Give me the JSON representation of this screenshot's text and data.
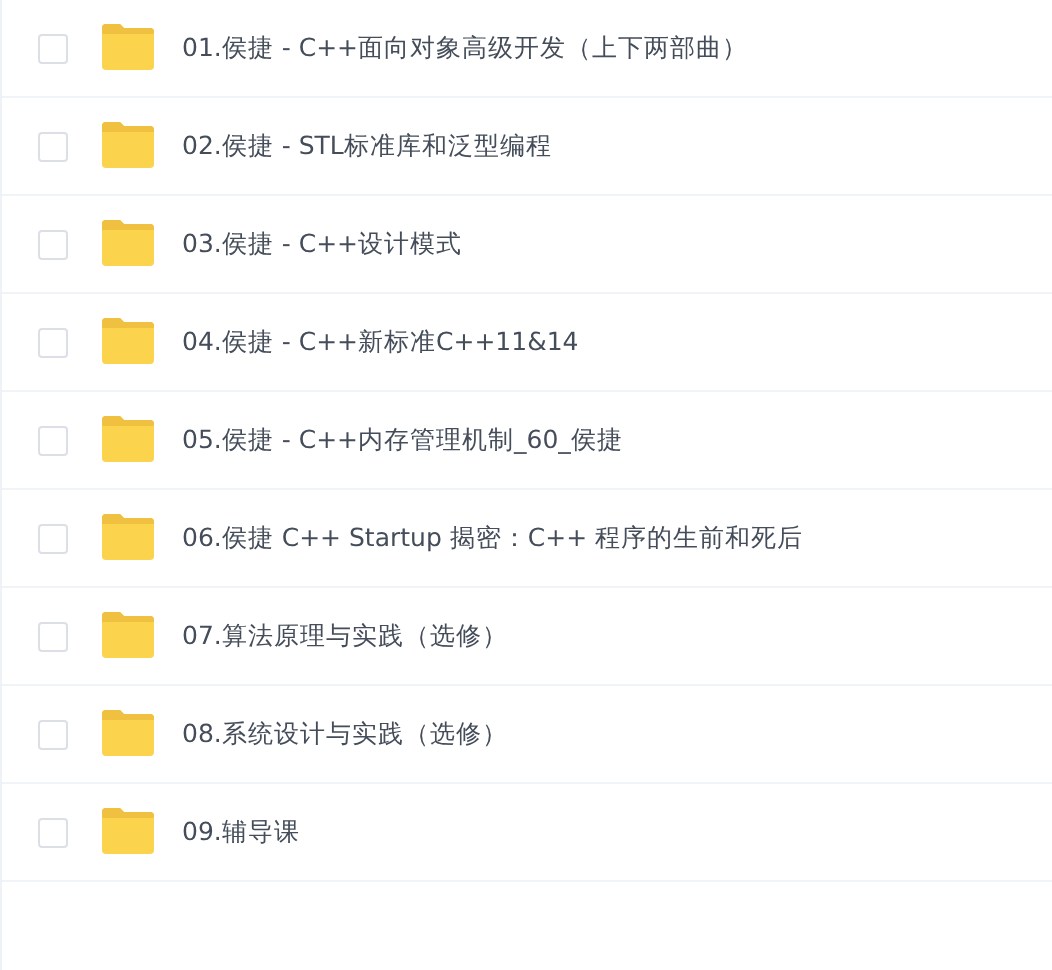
{
  "files": [
    {
      "name": "01.侯捷 - C++面向对象高级开发（上下两部曲）",
      "checked": false
    },
    {
      "name": "02.侯捷 - STL标准库和泛型编程",
      "checked": false
    },
    {
      "name": "03.侯捷 - C++设计模式",
      "checked": false
    },
    {
      "name": "04.侯捷 - C++新标准C++11&14",
      "checked": false
    },
    {
      "name": "05.侯捷 - C++内存管理机制_60_侯捷",
      "checked": false
    },
    {
      "name": "06.侯捷 C++ Startup 揭密：C++ 程序的生前和死后",
      "checked": false
    },
    {
      "name": "07.算法原理与实践（选修）",
      "checked": false
    },
    {
      "name": "08.系统设计与实践（选修）",
      "checked": false
    },
    {
      "name": "09.辅导课",
      "checked": false
    }
  ]
}
